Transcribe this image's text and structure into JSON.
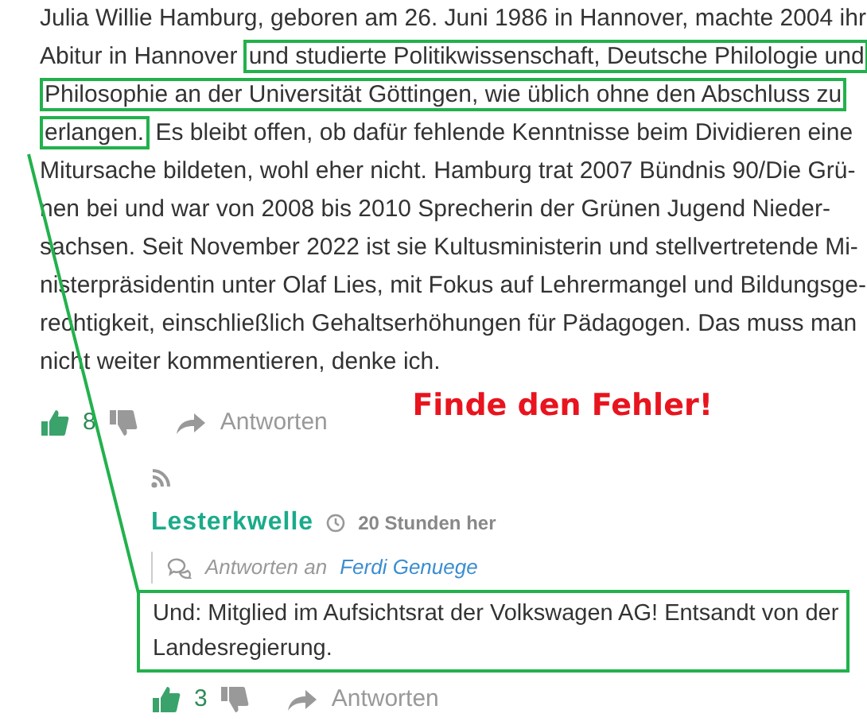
{
  "comment": {
    "parts": [
      {
        "text": "Julia Willie Hamburg, geboren am 26. Juni 1986 in Hannover, machte 2004 ihr\nAbitur in Hannover ",
        "highlighted": false
      },
      {
        "text": "und studierte Politikwissenschaft, Deutsche Philologie und\nPhilosophie an der Universität Göttingen, wie üblich ohne den Abschluss zu\nerlangen.",
        "highlighted": true
      },
      {
        "text": " Es bleibt offen, ob dafür fehlende Kenntnisse beim Dividieren eine\nMitursache bildeten, wohl eher nicht. Hamburg trat 2007 Bündnis 90/Die Grü-\nnen bei und war von 2008 bis 2010 Sprecherin der Grünen Jugend Nieder-\nsachsen. Seit November 2022 ist sie Kultusministerin und stellvertretende Mi-\nnisterpräsidentin unter Olaf Lies, mit Fokus auf Lehrermangel und Bildungsge-\nrechtigkeit, einschließlich Gehaltserhöhungen für Pädagogen. Das muss man\nnicht weiter kommentieren, denke ich.",
        "highlighted": false
      }
    ],
    "likes": "8",
    "reply_label": "Antworten"
  },
  "annotation": "Finde den Fehler!",
  "reply": {
    "author": "Lesterkwelle",
    "time": "20 Stunden her",
    "reply_to_label": "Antworten an",
    "reply_to_name": "Ferdi Genuege",
    "text": "Und: Mitglied im Aufsichtsrat der Volkswagen AG! Entsandt von der\nLandesregierung.",
    "highlighted": true,
    "likes": "3",
    "reply_label": "Antworten"
  }
}
